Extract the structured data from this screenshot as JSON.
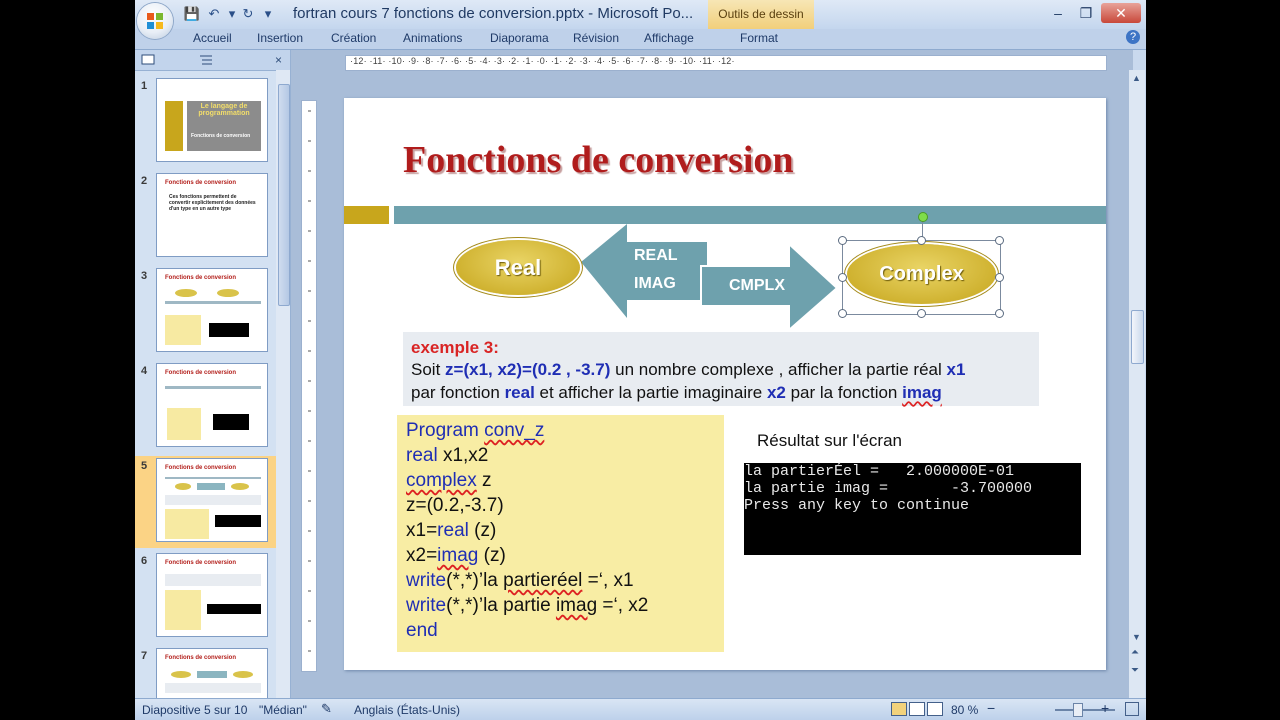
{
  "window": {
    "title": "fortran cours 7 fonctions de conversion.pptx - Microsoft Po...",
    "contextual_tab": "Outils de dessin",
    "controls": {
      "minimize": "–",
      "maximize": "❐",
      "close": "✕"
    }
  },
  "quick_access": {
    "save": "💾",
    "undo": "↶",
    "dropdown": "▾",
    "redo": "↻"
  },
  "ribbon": {
    "tabs": [
      "Accueil",
      "Insertion",
      "Création",
      "Animations",
      "Diaporama",
      "Révision",
      "Affichage",
      "Format"
    ],
    "help": "?"
  },
  "left_pane": {
    "close": "×",
    "slides": [
      {
        "num": "1",
        "title": "Le langage de programmation",
        "sub": "Fonctions de conversion"
      },
      {
        "num": "2",
        "title": "Fonctions de conversion",
        "sub": "Ces fonctions permettent de convertir explicitement des données d'un type en un autre type"
      },
      {
        "num": "3",
        "title": "Fonctions de conversion"
      },
      {
        "num": "4",
        "title": "Fonctions de conversion"
      },
      {
        "num": "5",
        "title": "Fonctions de conversion"
      },
      {
        "num": "6",
        "title": "Fonctions de conversion"
      },
      {
        "num": "7",
        "title": "Fonctions de conversion"
      }
    ],
    "selected_index": 4
  },
  "ruler": {
    "horizontal": "·12·  ·11·  ·10·  ·9·  ·8·  ·7·  ·6·  ·5·  ·4·  ·3·  ·2·  ·1·  ·0·  ·1·  ·2·  ·3·  ·4·  ·5·  ·6·  ·7·  ·8·  ·9·  ·10·  ·11·  ·12·"
  },
  "slide": {
    "title": "Fonctions de conversion",
    "diagram": {
      "left": "Real",
      "right": "Complex",
      "arrow_left_labels": [
        "REAL",
        "IMAG"
      ],
      "arrow_right_label": "CMPLX"
    },
    "example": {
      "title": "exemple 3:",
      "line1_a": "Soit ",
      "line1_b": "z=(x1, x2)=(0.2 , -3.7)",
      "line1_c": " un nombre complexe , afficher la partie réal ",
      "line1_d": "x1",
      "line2_a": "par fonction ",
      "line2_b": "real",
      "line2_c": " et afficher la partie imaginaire ",
      "line2_d": "x2",
      "line2_e": " par la fonction ",
      "line2_f": "imag"
    },
    "code": {
      "l1_kw": "Program ",
      "l1_name": "conv_z",
      "l2_kw": "real",
      "l2_rest": " x1,x2",
      "l3_kw": "complex",
      "l3_rest": "  z",
      "l4": "z=(0.2,-3.7)",
      "l5_a": "x1=",
      "l5_kw": "real",
      "l5_b": " (z)",
      "l6_a": "x2=",
      "l6_kw": "imag",
      "l6_b": " (z)",
      "l7_kw": "write",
      "l7_a": "(*,*)’la ",
      "l7_sq": "partieréel",
      "l7_b": " =‘, x1",
      "l8_kw": "write",
      "l8_a": "(*,*)’la partie ",
      "l8_sq": "imag",
      "l8_b": " =‘, x2",
      "l9_kw": "end"
    },
    "result_label": "Résultat sur l'écran",
    "terminal": [
      "la partierÉel =   2.000000E-01",
      "la partie imag =       -3.700000",
      "Press any key to continue"
    ]
  },
  "status": {
    "slide_info": "Diapositive 5 sur 10",
    "theme": "\"Médian\"",
    "language": "Anglais (États-Unis)",
    "zoom": "80 %",
    "zoom_minus": "−",
    "zoom_plus": "+"
  },
  "colors": {
    "title_red": "#b01c1c",
    "keyword_blue": "#1f2eb4",
    "code_box": "#f8eda4",
    "teal_bar": "#6ea1ad",
    "gold": "#c8a61c"
  }
}
